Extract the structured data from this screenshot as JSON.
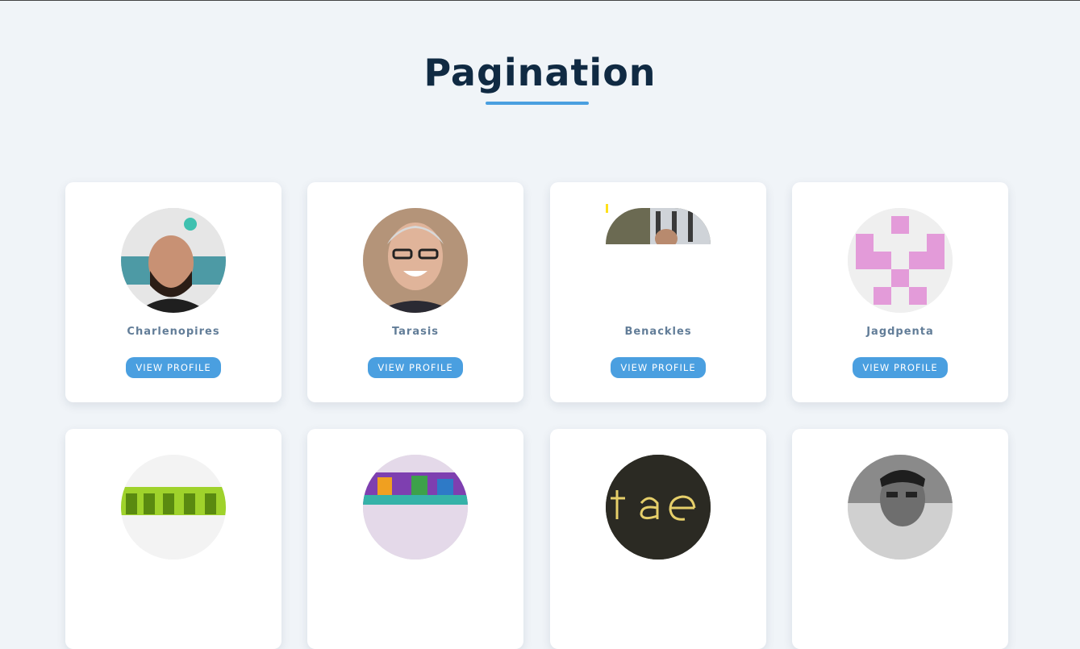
{
  "page": {
    "title": "Pagination"
  },
  "button_label": "VIEW PROFILE",
  "users": [
    {
      "name": "Charlenopires",
      "avatar": "photo-bearded-man"
    },
    {
      "name": "Tarasis",
      "avatar": "photo-smiling-man-glasses"
    },
    {
      "name": "Benackles",
      "avatar": "photo-partially-loaded"
    },
    {
      "name": "Jagdpenta",
      "avatar": "identicon-pink"
    },
    {
      "name": "",
      "avatar": "logo-miko"
    },
    {
      "name": "",
      "avatar": "logo-sauvage"
    },
    {
      "name": "",
      "avatar": "logo-tae"
    },
    {
      "name": "",
      "avatar": "photo-grayscale-man"
    }
  ],
  "colors": {
    "background": "#f0f4f8",
    "title": "#102a43",
    "accent": "#4a9fe0",
    "username": "#627d98",
    "identicon": "#e39bd9"
  }
}
